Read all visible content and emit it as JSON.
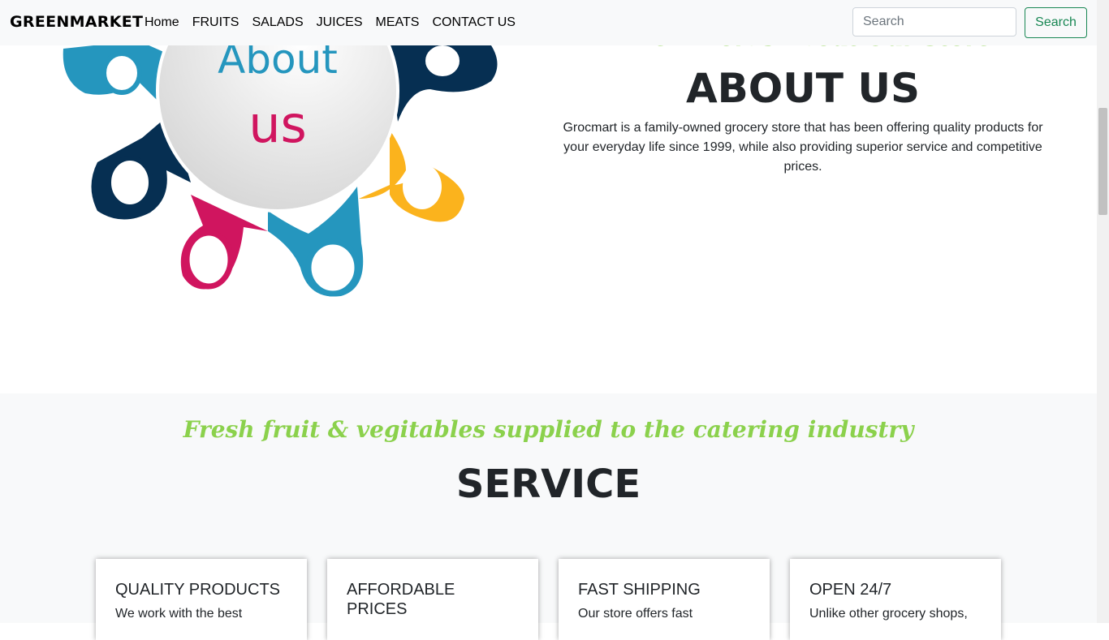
{
  "navbar": {
    "brand": "GREENMARKET",
    "links": [
      "Home",
      "FRUITS",
      "SALADS",
      "JUICES",
      "MEATS",
      "CONTACT US"
    ],
    "search_placeholder": "Search",
    "search_button": "Search"
  },
  "about": {
    "image_text_line1": "About",
    "image_text_line2": "us",
    "subtitle": "A Few Words About Our Store",
    "title": "ABOUT US",
    "text": "Grocmart is a family-owned grocery store that has been offering quality products for your everyday life since 1999, while also providing superior service and competitive prices."
  },
  "service": {
    "subtitle": "Fresh fruit & vegitables supplied to the catering industry",
    "title": "SERVICE",
    "cards": [
      {
        "title": "QUALITY PRODUCTS",
        "text": "We work with the best"
      },
      {
        "title": "AFFORDABLE PRICES",
        "text": ""
      },
      {
        "title": "FAST SHIPPING",
        "text": "Our store offers fast"
      },
      {
        "title": "OPEN 24/7",
        "text": "Unlike other grocery shops,"
      }
    ]
  },
  "colors": {
    "accent_green": "#8bd14c",
    "button_green": "#198754",
    "navbar_bg": "#f8f9fa",
    "logo_blue": "#2596be",
    "logo_navy": "#062f52",
    "logo_pink": "#d0155f",
    "logo_yellow": "#fbb31d"
  }
}
